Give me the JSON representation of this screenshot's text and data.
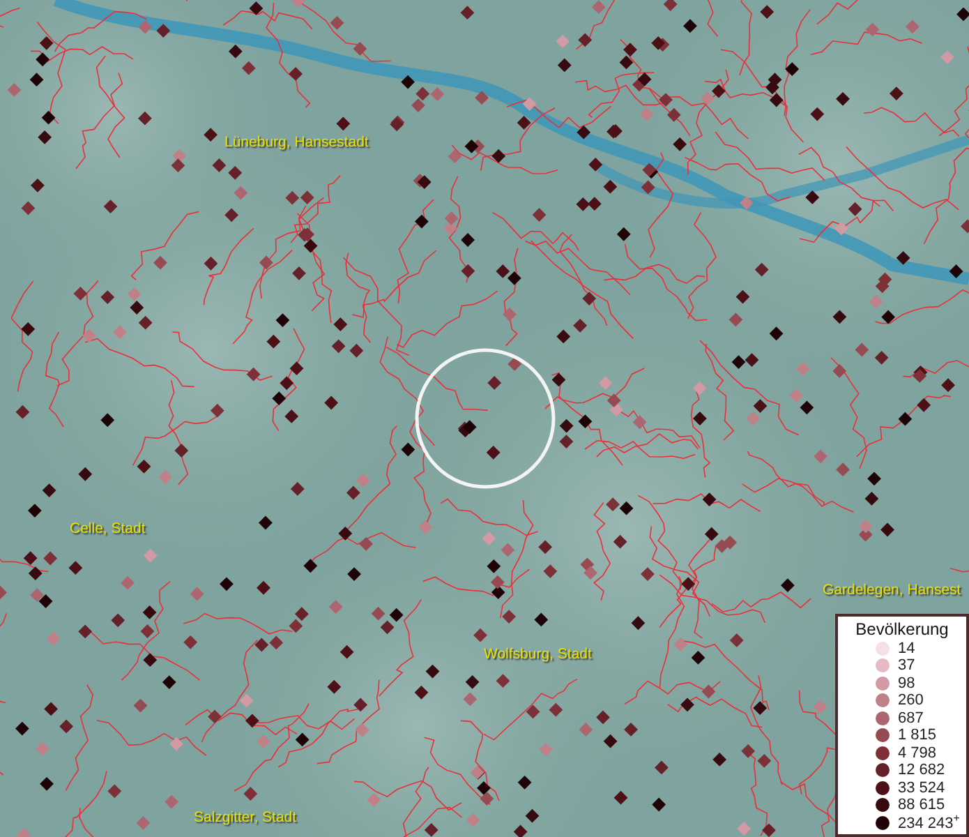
{
  "map": {
    "places": [
      {
        "name": "Lüneburg, Hansestadt"
      },
      {
        "name": "Celle, Stadt"
      },
      {
        "name": "Gardelegen, Hansest"
      },
      {
        "name": "Wolfsburg, Stadt"
      },
      {
        "name": "Salzgitter, Stadt"
      }
    ]
  },
  "legend": {
    "title": "Bevölkerung",
    "items": [
      {
        "label": "14",
        "color": "#f6dfe8"
      },
      {
        "label": "37",
        "color": "#e6b9c4"
      },
      {
        "label": "98",
        "color": "#d29aa5"
      },
      {
        "label": "260",
        "color": "#c08088"
      },
      {
        "label": "687",
        "color": "#ad6670"
      },
      {
        "label": "1 815",
        "color": "#964a52"
      },
      {
        "label": "4 798",
        "color": "#7e3038"
      },
      {
        "label": "12 682",
        "color": "#66202a"
      },
      {
        "label": "33 524",
        "color": "#4c1016"
      },
      {
        "label": "88 615",
        "color": "#360a0e"
      },
      {
        "label": "234 243$^{+}$",
        "color": "#1e0406"
      }
    ]
  }
}
